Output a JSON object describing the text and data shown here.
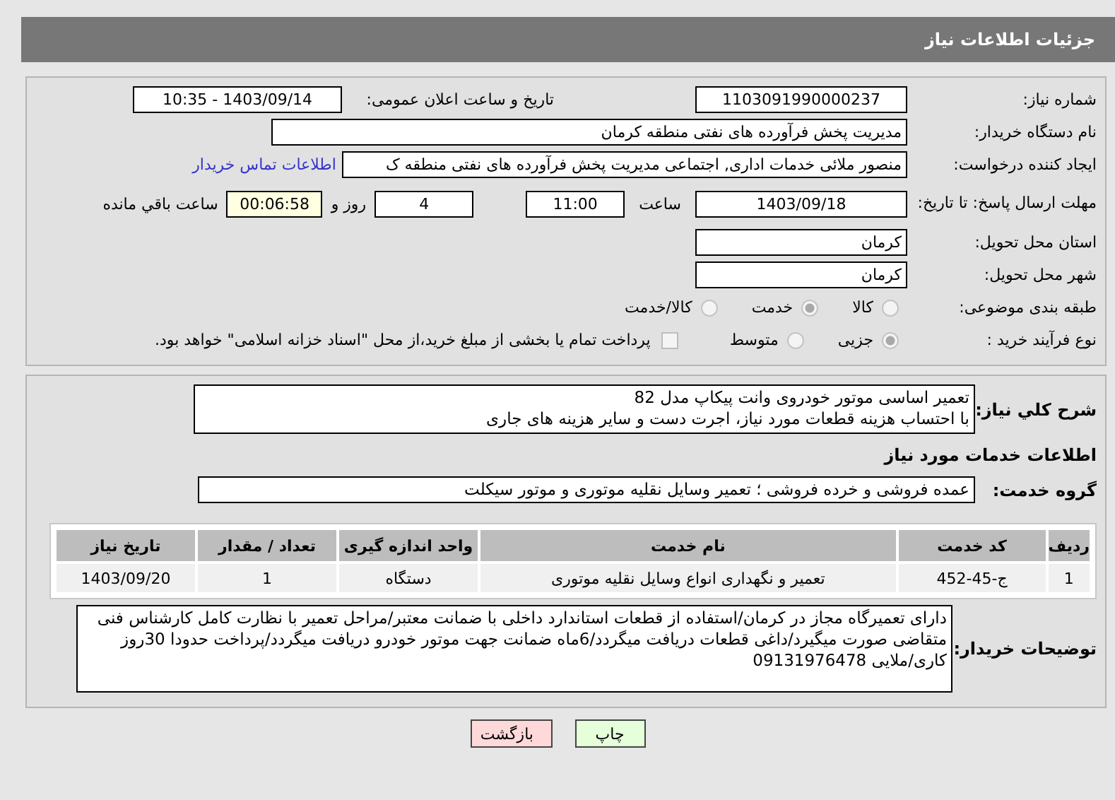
{
  "header": {
    "title": "جزئیات اطلاعات نیاز"
  },
  "need_number": {
    "label": "شماره نیاز:",
    "value": "1103091990000237"
  },
  "announce": {
    "label": "تاریخ و ساعت اعلان عمومی:",
    "value": "1403/09/14 - 10:35"
  },
  "buyer_org": {
    "label": "نام دستگاه خریدار:",
    "value": "مدیریت پخش فرآورده های نفتی منطقه کرمان"
  },
  "requester": {
    "label": "ایجاد کننده درخواست:",
    "value": "منصور ملائی خدمات اداری, اجتماعی  مدیریت پخش فرآورده های نفتی منطقه ک",
    "link": "اطلاعات تماس خریدار"
  },
  "deadline": {
    "label": "مهلت ارسال پاسخ: تا تاریخ:",
    "date": "1403/09/18",
    "time_label": "ساعت",
    "time": "11:00",
    "days": "4",
    "days_label": "روز و",
    "remaining": "00:06:58",
    "remaining_label": "ساعت باقي مانده"
  },
  "province": {
    "label": "استان محل تحویل:",
    "value": "کرمان"
  },
  "city": {
    "label": "شهر محل تحویل:",
    "value": "کرمان"
  },
  "category": {
    "label": "طبقه بندی موضوعی:",
    "options": [
      {
        "label": "کالا",
        "selected": false
      },
      {
        "label": "خدمت",
        "selected": true
      },
      {
        "label": "کالا/خدمت",
        "selected": false
      }
    ]
  },
  "process": {
    "label": "نوع فرآیند خرید :",
    "options": [
      {
        "label": "جزیی",
        "selected": true
      },
      {
        "label": "متوسط",
        "selected": false
      }
    ],
    "payment": {
      "checked": false,
      "text": "پرداخت تمام یا بخشی از مبلغ خرید،از محل \"اسناد خزانه اسلامی\" خواهد بود."
    }
  },
  "description": {
    "label": "شرح کلي نیاز:",
    "text": "تعمیر اساسی موتور خودروی وانت پیکاپ مدل 82\nبا احتساب هزینه قطعات مورد نیاز، اجرت دست و سایر هزینه های جاری"
  },
  "services_heading": "اطلاعات خدمات مورد نیاز",
  "service_group": {
    "label": "گروه خدمت:",
    "value": "عمده فروشی و خرده فروشی ؛ تعمیر وسایل نقلیه موتوری و موتور سیکلت"
  },
  "table": {
    "columns": [
      "ردیف",
      "کد خدمت",
      "نام خدمت",
      "واحد اندازه گیری",
      "تعداد / مقدار",
      "تاریخ نیاز"
    ],
    "rows": [
      [
        "1",
        "ج-45-452",
        "تعمیر و نگهداری انواع وسایل نقلیه موتوری",
        "دستگاه",
        "1",
        "1403/09/20"
      ]
    ]
  },
  "buyer_notes": {
    "label": "توضیحات خریدار:",
    "text": "دارای تعمیرگاه مجاز در کرمان/استفاده از قطعات استاندارد داخلی با ضمانت معتبر/مراحل تعمیر با نظارت کامل کارشناس فنی متقاضی صورت میگیرد/داغی قطعات دریافت میگردد/6ماه ضمانت جهت موتور خودرو دریافت میگردد/پرداخت حدودا 30روز کاری/ملایی 09131976478"
  },
  "buttons": [
    {
      "label": "چاپ",
      "kind": "print"
    },
    {
      "label": "بازگشت",
      "kind": "back"
    }
  ]
}
